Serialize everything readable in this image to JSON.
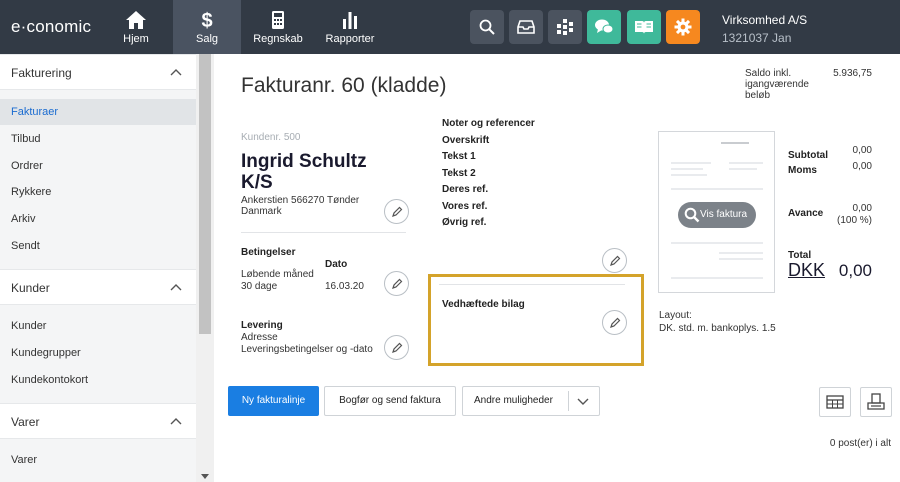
{
  "app": {
    "logo": "e·conomic"
  },
  "nav": [
    {
      "label": "Hjem",
      "icon": "home-icon"
    },
    {
      "label": "Salg",
      "icon": "dollar-icon"
    },
    {
      "label": "Regnskab",
      "icon": "calculator-icon"
    },
    {
      "label": "Rapporter",
      "icon": "bar-chart-icon"
    }
  ],
  "toolbar": {
    "icons": [
      "search-icon",
      "inbox-icon",
      "apps-icon",
      "chat-icon",
      "book-icon",
      "gear-icon"
    ],
    "colors": {
      "chat": "#3fb99a",
      "book": "#3fb99a",
      "gear": "#f6881f",
      "default": "#4b535f"
    }
  },
  "company": {
    "name": "Virksomhed A/S",
    "sub": "1321037 Jan"
  },
  "sidebar": {
    "sections": [
      {
        "title": "Fakturering",
        "items": [
          "Fakturaer",
          "Tilbud",
          "Ordrer",
          "Rykkere",
          "Arkiv",
          "Sendt"
        ],
        "active": "Fakturaer"
      },
      {
        "title": "Kunder",
        "items": [
          "Kunder",
          "Kundegrupper",
          "Kundekontokort"
        ]
      },
      {
        "title": "Varer",
        "items": [
          "Varer"
        ]
      }
    ]
  },
  "invoice": {
    "title": "Fakturanr. 60 (kladde)",
    "saldo_label": "Saldo inkl. igangværende beløb",
    "saldo_value": "5.936,75",
    "customer_no": "Kundenr. 500",
    "customer_name": "Ingrid Schultz K/S",
    "address_line1": "Ankerstien 566270 Tønder",
    "address_line2": "Danmark",
    "conditions_label": "Betingelser",
    "conditions_line1": "Løbende måned",
    "conditions_line2": "30 dage",
    "date_label": "Dato",
    "date_value": "16.03.20",
    "delivery_label": "Levering",
    "delivery_line1": "Adresse",
    "delivery_line2": "Leveringsbetingelser og -dato",
    "notes": [
      "Noter og referencer",
      "Overskrift",
      "Tekst 1",
      "Tekst 2",
      "Deres ref.",
      "Vores ref.",
      "Øvrig ref."
    ],
    "attachments_label": "Vedhæftede bilag",
    "view_invoice": "Vis faktura",
    "subtotal_label": "Subtotal",
    "subtotal_value": "0,00",
    "vat_label": "Moms",
    "vat_value": "0,00",
    "margin_label": "Avance",
    "margin_value": "0,00",
    "margin_pct": "(100 %)",
    "total_label": "Total",
    "currency": "DKK",
    "total_value": "0,00",
    "layout_label": "Layout:",
    "layout_value": "DK. std. m. bankoplys. 1.5"
  },
  "actions": {
    "new_line": "Ny fakturalinje",
    "book_send": "Bogfør og send faktura",
    "more": "Andre muligheder",
    "posts": "0 post(er) i alt"
  }
}
